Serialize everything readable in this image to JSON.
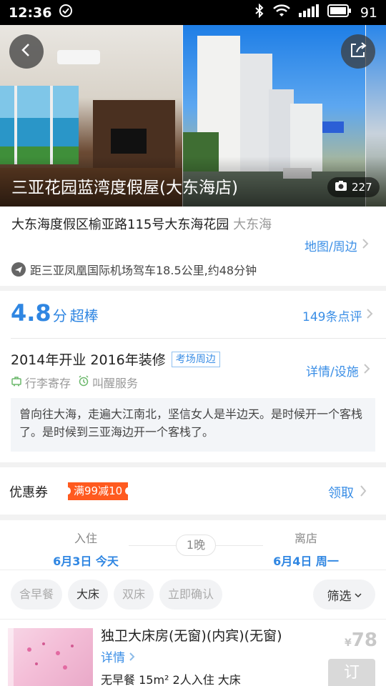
{
  "status_bar": {
    "time": "12:36",
    "battery": "91",
    "icons": [
      "check-circle-icon",
      "bluetooth-icon",
      "wifi-icon",
      "signal-icon",
      "battery-icon"
    ]
  },
  "hotel": {
    "name": "三亚花园蓝湾度假屋(大东海店)",
    "photo_count": "227",
    "address": "大东海度假区榆亚路115号大东海花园",
    "district": "大东海",
    "map_link": "地图/周边",
    "distance": "距三亚凤凰国际机场驾车18.5公里,约48分钟"
  },
  "rating": {
    "score": "4.8",
    "unit": "分",
    "label": "超棒",
    "reviews": "149条点评"
  },
  "facilities": {
    "years": "2014年开业 2016年装修",
    "tag": "考场周边",
    "link": "详情/设施",
    "services": [
      "行李寄存",
      "叫醒服务"
    ]
  },
  "quote": "曾向往大海，走遍大江南北，坚信女人是半边天。是时候开一个客栈了。是时候到三亚海边开一个客栈了。",
  "coupon": {
    "title": "优惠券",
    "badge": "满99减10",
    "claim": "领取"
  },
  "booking": {
    "checkin_label": "入住",
    "checkin_date": "6月3日 今天",
    "nights": "1晚",
    "checkout_label": "离店",
    "checkout_date": "6月4日 周一",
    "filters": [
      "含早餐",
      "大床",
      "双床",
      "立即确认"
    ],
    "filter_button": "筛选"
  },
  "room": {
    "title": "独卫大床房(无窗)(内宾)(无窗)",
    "detail": "详情",
    "meta": "无早餐 15m² 2人入住 大床",
    "currency": "¥",
    "price": "78",
    "book": "订"
  },
  "colors": {
    "accent": "#2f86e2",
    "coupon": "#ff5a1f"
  }
}
